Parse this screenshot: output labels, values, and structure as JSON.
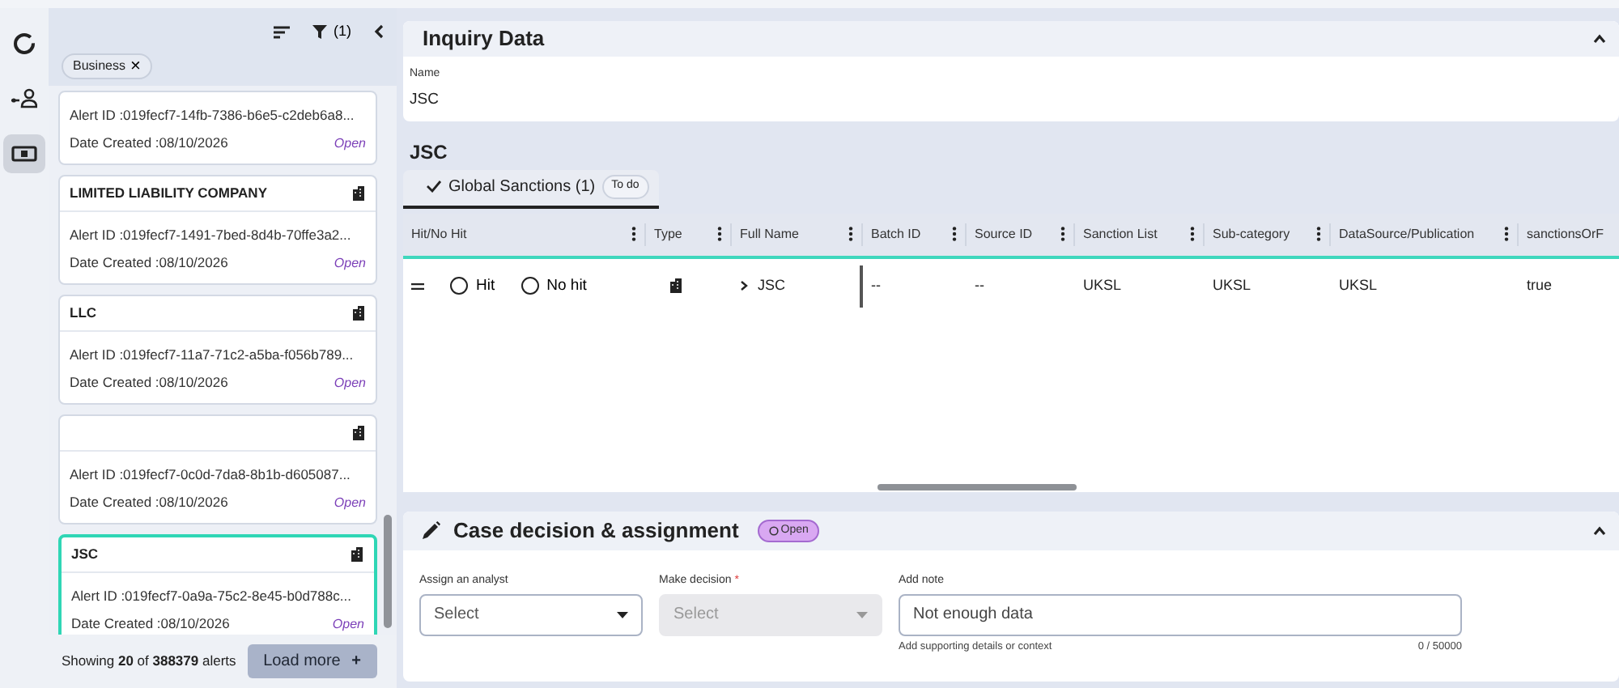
{
  "rail": {
    "items": [
      {
        "selected": false
      },
      {
        "selected": false
      },
      {
        "selected": true
      }
    ]
  },
  "alerts_panel": {
    "filter_count": "(1)",
    "chips": [
      {
        "label": "Business",
        "close": "×"
      }
    ],
    "cards": [
      {
        "kind": "clipped",
        "alert_id": "Alert ID :019fecf7-14fb-7386-b6e5-c2deb6a8...",
        "date": "Date Created :08/10/2026",
        "status": "Open",
        "selected": false
      },
      {
        "kind": "full",
        "title": "LIMITED LIABILITY COMPANY",
        "alert_id": "Alert ID :019fecf7-1491-7bed-8d4b-70ffe3a2...",
        "date": "Date Created :08/10/2026",
        "status": "Open",
        "selected": false
      },
      {
        "kind": "full",
        "title": "LLC",
        "alert_id": "Alert ID :019fecf7-11a7-71c2-a5ba-f056b789...",
        "date": "Date Created :08/10/2026",
        "status": "Open",
        "selected": false
      },
      {
        "kind": "full",
        "alert_id": "Alert ID :019fecf7-0c0d-7da8-8b1b-d605087...",
        "date": "Date Created :08/10/2026",
        "status": "Open",
        "selected": false
      },
      {
        "kind": "full",
        "title": "JSC",
        "alert_id": "Alert ID :019fecf7-0a9a-75c2-8e45-b0d788c...",
        "date": "Date Created :08/10/2026",
        "status": "Open",
        "selected": true
      }
    ],
    "footer": {
      "summary": "Showing **20** of **388379** alerts",
      "load_more": "Load more",
      "load_more_icon": "+"
    }
  },
  "inquiry": {
    "title": "Inquiry Data",
    "expanded": true,
    "fields": [
      {
        "label": "Name",
        "value": "JSC"
      }
    ]
  },
  "results": {
    "title": "JSC",
    "tabs": [
      {
        "label": "Global Sanctions (1)",
        "badge": "To do",
        "selected": true
      }
    ],
    "table": {
      "columns": [
        "Hit/No Hit",
        "Type",
        "Full Name",
        "Batch ID",
        "Source ID",
        "Sanction List",
        "Sub-category",
        "DataSource/Publication",
        "sanctionsOrF"
      ],
      "rows": [
        {
          "cells": [
            {
              "kind": "decision",
              "options": [
                {
                  "label": "Hit",
                  "selected": false
                },
                {
                  "label": "No hit",
                  "selected": false
                }
              ]
            },
            {
              "kind": "type"
            },
            {
              "kind": "name",
              "text": "JSC"
            },
            {
              "kind": "text",
              "text": "--"
            },
            {
              "kind": "text",
              "text": "--"
            },
            {
              "kind": "text",
              "text": "UKSL"
            },
            {
              "kind": "text",
              "text": "UKSL"
            },
            {
              "kind": "text",
              "text": "UKSL"
            },
            {
              "kind": "text",
              "text": "true"
            }
          ]
        }
      ]
    }
  },
  "decision": {
    "title": "Case decision & assignment",
    "status": "Open",
    "expanded": true,
    "analyst": {
      "label": "Assign an analyst",
      "placeholder": "Select",
      "disabled": false
    },
    "decision": {
      "label": "Make decision",
      "required": "*",
      "placeholder": "Select",
      "disabled": true
    },
    "note": {
      "label": "Add note",
      "placeholder": "Not enough data",
      "hint": "Add supporting details or context",
      "counter": "0 / 50000"
    }
  }
}
